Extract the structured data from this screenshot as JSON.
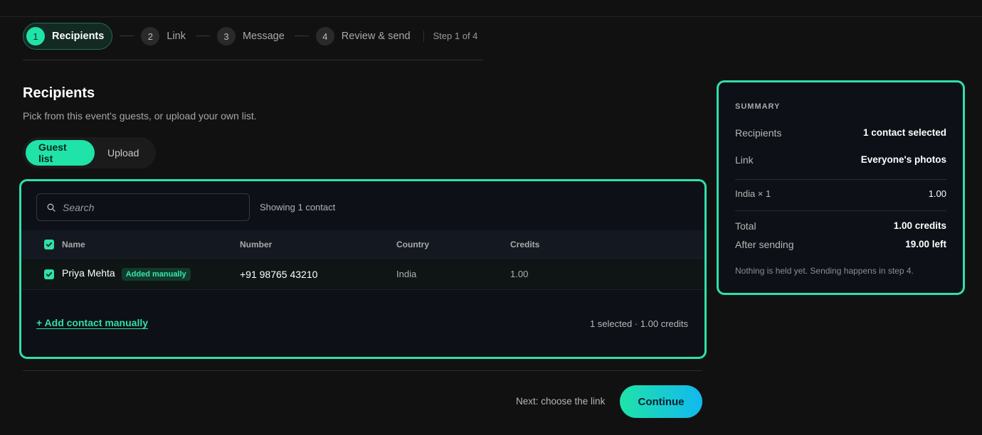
{
  "stepper": {
    "steps": [
      {
        "num": "1",
        "label": "Recipients"
      },
      {
        "num": "2",
        "label": "Link"
      },
      {
        "num": "3",
        "label": "Message"
      },
      {
        "num": "4",
        "label": "Review & send"
      }
    ],
    "count_text": "Step 1 of 4"
  },
  "header": {
    "title": "Recipients",
    "subtitle": "Pick from this event's guests, or upload your own list."
  },
  "source_toggle": {
    "options": [
      "Guest list",
      "Upload"
    ],
    "selected": "Guest list"
  },
  "table": {
    "search_placeholder": "Search",
    "showing_text": "Showing 1 contact",
    "columns": [
      "Name",
      "Number",
      "Country",
      "Credits"
    ],
    "rows": [
      {
        "name": "Priya Mehta",
        "badge": "Added manually",
        "number": "+91 98765 43210",
        "country": "India",
        "credits": "1.00",
        "checked": true
      }
    ],
    "add_link": "+ Add contact manually",
    "selection_summary": "1 selected · 1.00 credits"
  },
  "footer": {
    "next_hint": "Next: choose the link",
    "continue_label": "Continue"
  },
  "summary": {
    "heading": "SUMMARY",
    "recipients_label": "Recipients",
    "recipients_value": "1 contact selected",
    "link_label": "Link",
    "link_value": "Everyone's photos",
    "country_line_label": "India × 1",
    "country_line_value": "1.00",
    "total_label": "Total",
    "total_value": "1.00 credits",
    "after_label": "After sending",
    "after_value": "19.00 left",
    "note": "Nothing is held yet. Sending happens in step 4."
  },
  "colors": {
    "accent": "#2fe0a8",
    "accent_gradient_end": "#12b8f0",
    "background": "#111111",
    "panel": "#0d1016"
  },
  "icons": {
    "search": "search-icon",
    "checkbox": "check-icon"
  }
}
